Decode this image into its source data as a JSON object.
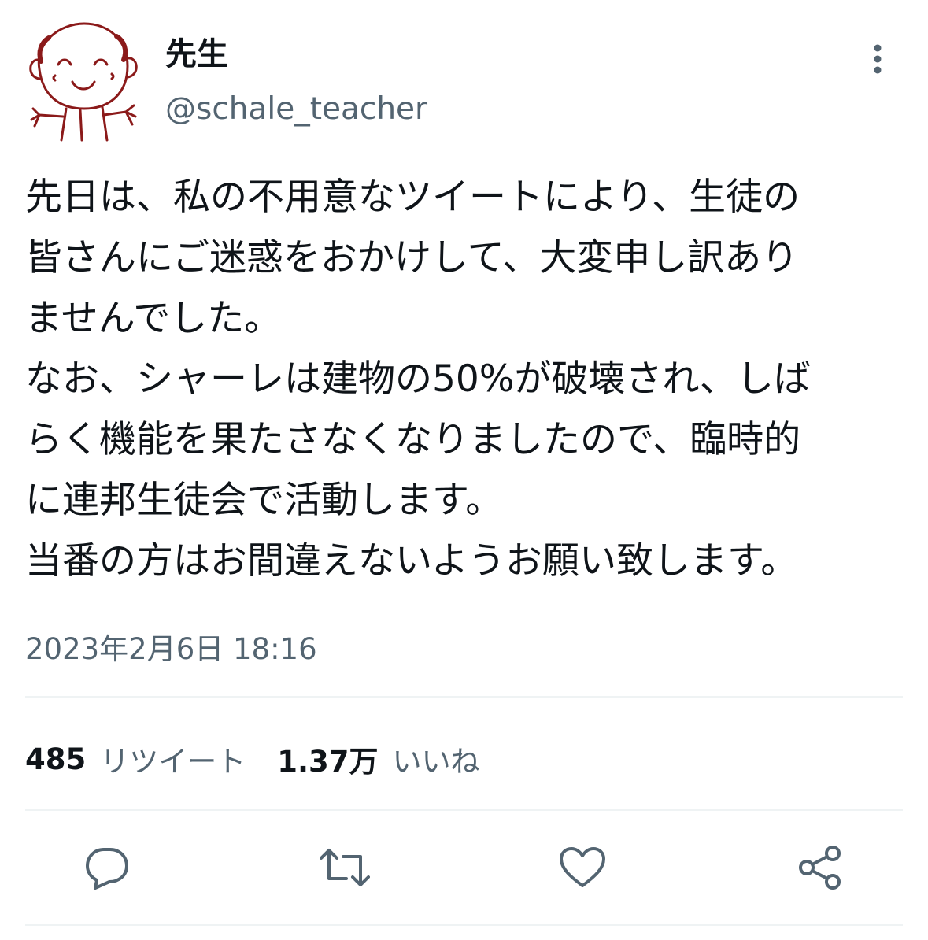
{
  "user": {
    "display_name": "先生",
    "handle": "@schale_teacher",
    "avatar_icon": "smiling-doodle-avatar"
  },
  "tweet": {
    "lines": [
      "先日は、私の不用意なツイートにより、生徒の",
      "皆さんにご迷惑をおかけして、大変申し訳あり",
      "ませんでした。",
      "なお、シャーレは建物の50%が破壊され、しば",
      "らく機能を果たさなくなりましたので、臨時的",
      "に連邦生徒会で活動します。",
      "当番の方はお間違えないようお願い致します。"
    ],
    "timestamp": "2023年2月6日 18:16"
  },
  "stats": {
    "retweets_count": "485",
    "retweets_label": "リツイート",
    "likes_count": "1.37万",
    "likes_label": "いいね"
  },
  "actions": {
    "reply_icon": "reply-icon",
    "retweet_icon": "retweet-icon",
    "like_icon": "heart-icon",
    "share_icon": "share-icon",
    "more_icon": "more-vertical-icon"
  },
  "colors": {
    "text_primary": "#0f1419",
    "text_secondary": "#536471",
    "divider": "#eff3f4",
    "avatar_line": "#8b1a1a"
  }
}
